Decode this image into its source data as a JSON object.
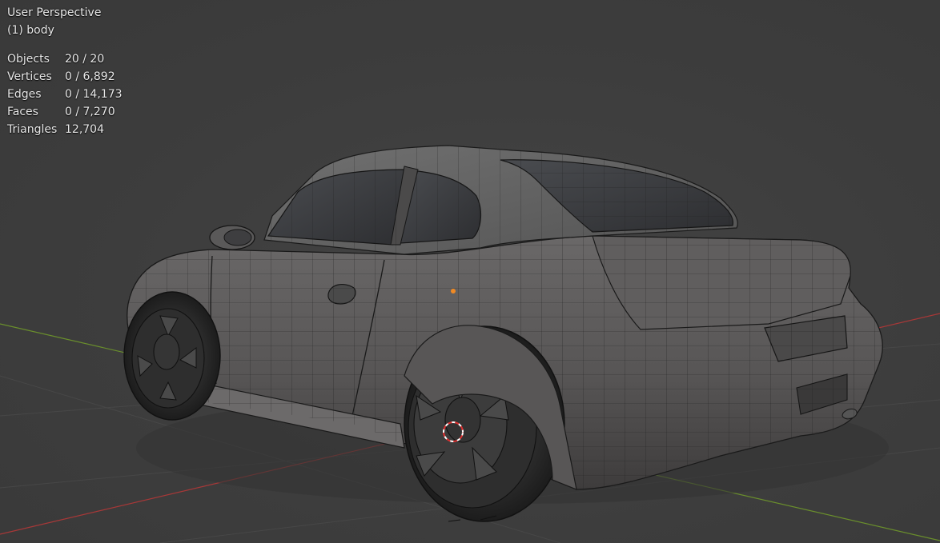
{
  "viewport": {
    "view_name": "User Perspective",
    "active_object": "(1) body"
  },
  "statistics": [
    {
      "label": "Objects",
      "value": "20 / 20"
    },
    {
      "label": "Vertices",
      "value": "0 / 6,892"
    },
    {
      "label": "Edges",
      "value": "0 / 14,173"
    },
    {
      "label": "Faces",
      "value": "0 / 7,270"
    },
    {
      "label": "Triangles",
      "value": "12,704"
    }
  ],
  "colors": {
    "background": "#3d3d3d",
    "x_axis": "#b23a3a",
    "y_axis": "#6f9a2e",
    "grid": "#4a4a4a",
    "mesh_fill": "#5a5858",
    "wire": "#1a1a1a",
    "cursor_red": "#e03030",
    "origin": "#f08a24"
  }
}
